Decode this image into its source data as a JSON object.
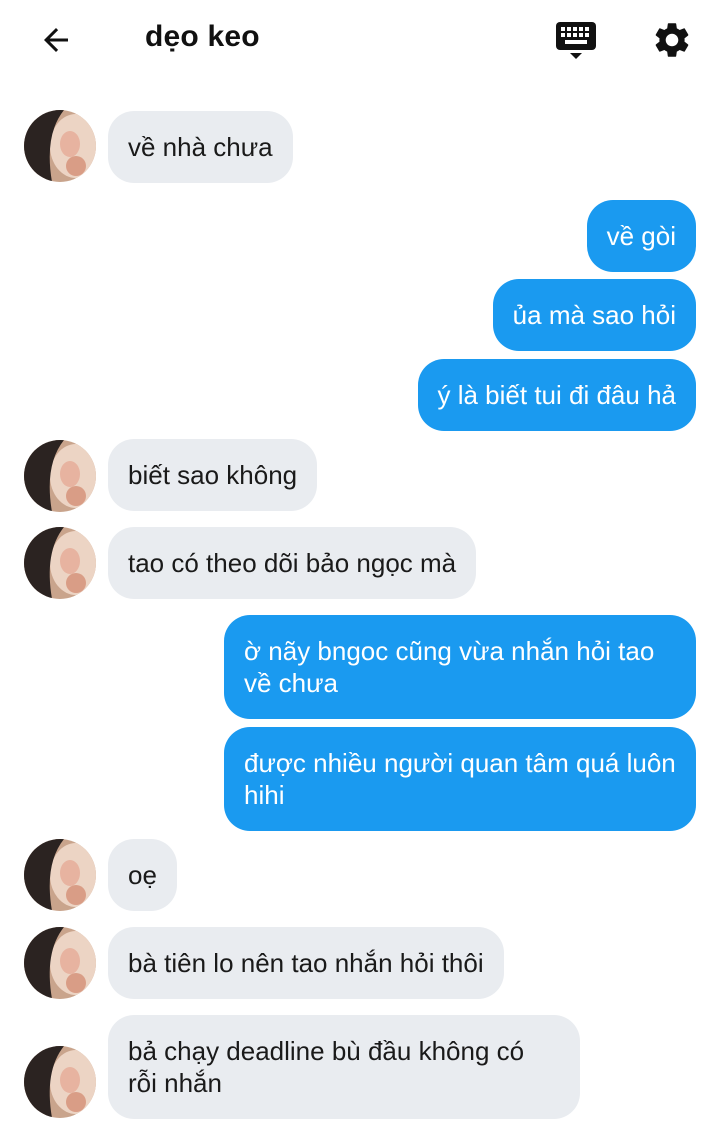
{
  "header": {
    "title": "dẹo keo",
    "back_icon": "arrow-left-icon",
    "keyboard_icon": "keyboard-icon",
    "settings_icon": "gear-icon"
  },
  "colors": {
    "outgoing_bubble": "#1a9af0",
    "incoming_bubble": "#e9ecf0",
    "background": "#ffffff"
  },
  "messages": [
    {
      "from": "them",
      "text": "về nhà chưa"
    },
    {
      "from": "me",
      "text": "về gòi"
    },
    {
      "from": "me",
      "text": "ủa mà sao hỏi"
    },
    {
      "from": "me",
      "text": "ý là biết tui đi đâu hả"
    },
    {
      "from": "them",
      "text": "biết sao không"
    },
    {
      "from": "them",
      "text": "tao có theo dõi bảo ngọc mà"
    },
    {
      "from": "me",
      "text": "ờ nãy bngoc cũng vừa nhắn hỏi tao về chưa"
    },
    {
      "from": "me",
      "text": "được nhiều người quan tâm quá luôn hihi"
    },
    {
      "from": "them",
      "text": "oẹ"
    },
    {
      "from": "them",
      "text": "bà tiên lo nên tao nhắn hỏi thôi"
    },
    {
      "from": "them",
      "text": "bả chạy deadline bù đầu không có rỗi nhắn"
    }
  ]
}
